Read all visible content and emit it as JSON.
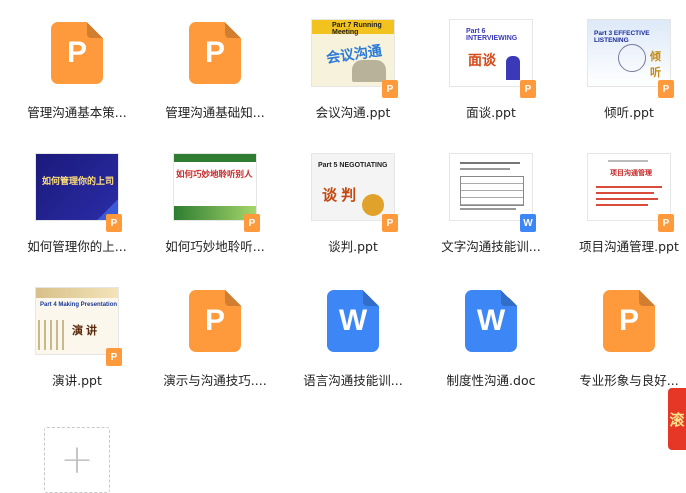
{
  "files": [
    {
      "name": "管理沟通基本策...",
      "type": "p"
    },
    {
      "name": "管理沟通基础知...",
      "type": "p"
    },
    {
      "name": "会议沟通.ppt",
      "type": "p",
      "thumb": {
        "title": "Part 7 Running Meeting",
        "cn": "会议沟通"
      }
    },
    {
      "name": "面谈.ppt",
      "type": "p",
      "thumb": {
        "title": "Part 6 INTERVIEWING",
        "cn": "面谈"
      }
    },
    {
      "name": "倾听.ppt",
      "type": "p",
      "thumb": {
        "title": "Part 3 EFFECTIVE LISTENING",
        "cn": "倾听"
      }
    },
    {
      "name": "如何管理你的上...",
      "type": "p",
      "thumb": {
        "title": "如何管理你的上司"
      }
    },
    {
      "name": "如何巧妙地聆听...",
      "type": "p",
      "thumb": {
        "title": "如何巧妙地聆听别人"
      }
    },
    {
      "name": "谈判.ppt",
      "type": "p",
      "thumb": {
        "title": "Part 5 NEGOTIATING",
        "cn": "谈 判"
      }
    },
    {
      "name": "文字沟通技能训...",
      "type": "w"
    },
    {
      "name": "项目沟通管理.ppt",
      "type": "p",
      "thumb": {
        "title": "项目沟通管理"
      }
    },
    {
      "name": "演讲.ppt",
      "type": "p",
      "thumb": {
        "title": "Part 4 Making Presentation",
        "cn": "演 讲"
      }
    },
    {
      "name": "演示与沟通技巧....",
      "type": "p"
    },
    {
      "name": "语言沟通技能训...",
      "type": "w"
    },
    {
      "name": "制度性沟通.doc",
      "type": "w"
    },
    {
      "name": "专业形象与良好...",
      "type": "p"
    }
  ],
  "icons": {
    "ppt_letter": "P",
    "doc_letter": "W",
    "add": "+"
  },
  "colors": {
    "ppt": "#ff9a3c",
    "doc": "#3d86f5"
  },
  "side_ad_text": "滚"
}
